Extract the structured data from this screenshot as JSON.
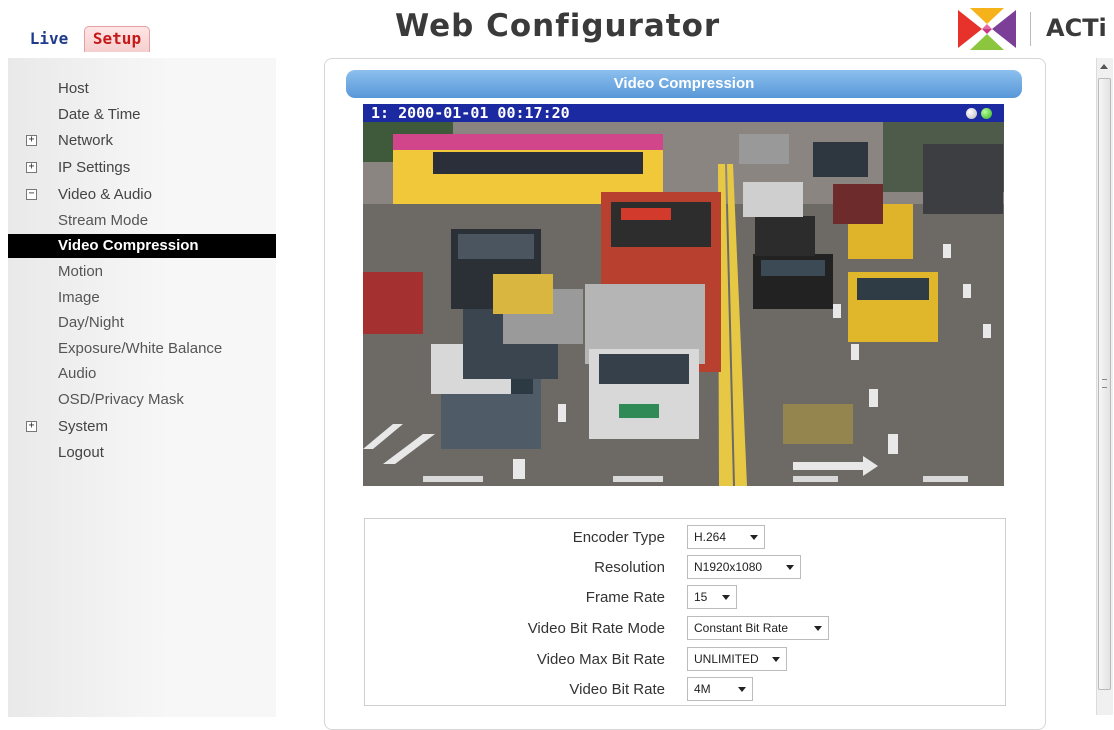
{
  "header": {
    "tabs": [
      {
        "label": "Live"
      },
      {
        "label": "Setup",
        "active": true
      }
    ],
    "title": "Web Configurator",
    "logo_text": "ACTi"
  },
  "sidebar": {
    "items": [
      {
        "label": "Host"
      },
      {
        "label": "Date & Time"
      },
      {
        "label": "Network",
        "toggle": "+"
      },
      {
        "label": "IP Settings",
        "toggle": "+"
      },
      {
        "label": "Video & Audio",
        "toggle": "−"
      },
      {
        "label": "Stream Mode"
      },
      {
        "label": "Video Compression",
        "active": true
      },
      {
        "label": "Motion"
      },
      {
        "label": "Image"
      },
      {
        "label": "Day/Night"
      },
      {
        "label": "Exposure/White Balance"
      },
      {
        "label": "Audio"
      },
      {
        "label": "OSD/Privacy Mask"
      },
      {
        "label": "System",
        "toggle": "+"
      },
      {
        "label": "Logout"
      }
    ]
  },
  "main": {
    "section_title": "Video Compression",
    "video": {
      "osd_text": "1:  2000-01-01 00:17:20"
    },
    "form": {
      "encoder_type": {
        "label": "Encoder Type",
        "value": "H.264"
      },
      "resolution": {
        "label": "Resolution",
        "value": "N1920x1080"
      },
      "frame_rate": {
        "label": "Frame Rate",
        "value": "15"
      },
      "bit_rate_mode": {
        "label": "Video Bit Rate Mode",
        "value": "Constant Bit Rate"
      },
      "max_bit_rate": {
        "label": "Video Max Bit Rate",
        "value": "UNLIMITED"
      },
      "bit_rate": {
        "label": "Video Bit Rate",
        "value": "4M"
      }
    }
  },
  "colors": {
    "section_header": "#5797d7",
    "active_nav": "#000000",
    "setup_tab": "#c61a1a",
    "live_tab": "#1f3b8c",
    "osd_bar": "#1b2aa0"
  }
}
